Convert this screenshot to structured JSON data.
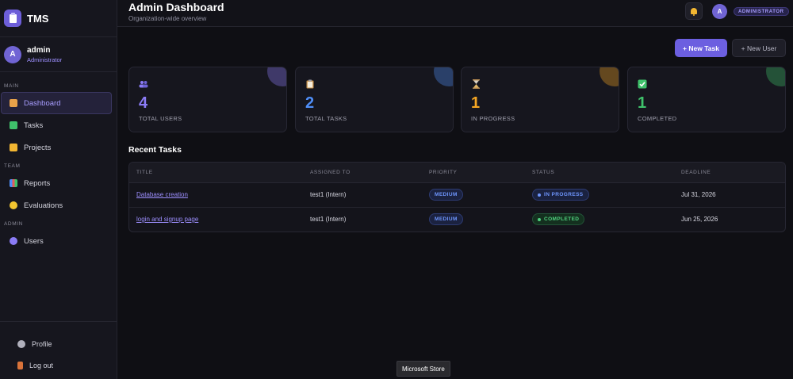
{
  "brand": {
    "name": "TMS"
  },
  "user": {
    "initial": "A",
    "name": "admin",
    "role": "Administrator"
  },
  "sidebar": {
    "sections": [
      {
        "label": "MAIN"
      },
      {
        "label": "TEAM"
      },
      {
        "label": "ADMIN"
      }
    ],
    "items": [
      {
        "label": "Dashboard",
        "icon": "house-icon",
        "active": true
      },
      {
        "label": "Tasks",
        "icon": "check-box-icon"
      },
      {
        "label": "Projects",
        "icon": "folder-icon"
      },
      {
        "label": "Reports",
        "icon": "bar-chart-icon"
      },
      {
        "label": "Evaluations",
        "icon": "star-icon"
      },
      {
        "label": "Users",
        "icon": "users-icon"
      }
    ],
    "bottom": [
      {
        "label": "Profile",
        "icon": "gear-icon"
      },
      {
        "label": "Log out",
        "icon": "door-icon"
      }
    ]
  },
  "header": {
    "title": "Admin Dashboard",
    "subtitle": "Organization-wide overview",
    "avatar_initial": "A",
    "role_badge": "ADMINISTRATOR"
  },
  "actions": {
    "new_task": "+ New Task",
    "new_user": "+ New User"
  },
  "stats": [
    {
      "value": "4",
      "label": "TOTAL USERS",
      "color": "#8b7cf6",
      "icon": "users-icon"
    },
    {
      "value": "2",
      "label": "TOTAL TASKS",
      "color": "#4f8ef7",
      "icon": "clipboard-icon"
    },
    {
      "value": "1",
      "label": "IN PROGRESS",
      "color": "#f5a623",
      "icon": "hourglass-icon"
    },
    {
      "value": "1",
      "label": "COMPLETED",
      "color": "#3fc26b",
      "icon": "check-box-icon"
    }
  ],
  "recent": {
    "title": "Recent Tasks",
    "columns": [
      "TITLE",
      "ASSIGNED TO",
      "PRIORITY",
      "STATUS",
      "DEADLINE"
    ],
    "rows": [
      {
        "title": "Database creation",
        "assigned": "test1 (Intern)",
        "priority": "MEDIUM",
        "status": "IN PROGRESS",
        "deadline": "Jul 31, 2026"
      },
      {
        "title": "login and signup page",
        "assigned": "test1 (Intern)",
        "priority": "MEDIUM",
        "status": "COMPLETED",
        "deadline": "Jun 25, 2026"
      }
    ]
  },
  "tooltip": "Microsoft Store"
}
